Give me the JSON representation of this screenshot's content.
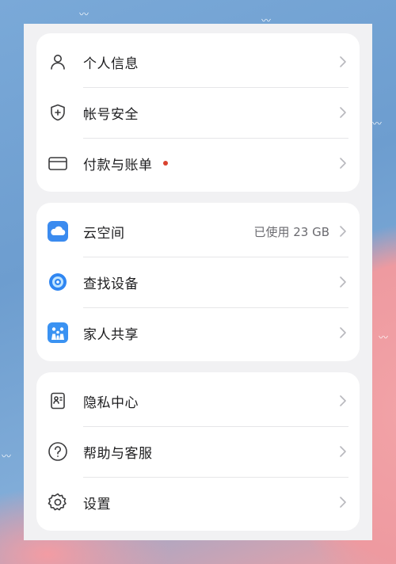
{
  "theme": {
    "accent_dot": "#d9432f",
    "cloud_blue": "#3b8bef",
    "find_blue": "#2f86f2",
    "family_blue": "#3a92f2"
  },
  "groups": [
    {
      "items": [
        {
          "label": "个人信息",
          "icon": "person-icon"
        },
        {
          "label": "帐号安全",
          "icon": "shield-icon"
        },
        {
          "label": "付款与账单",
          "icon": "card-icon",
          "badge": "red-dot"
        }
      ]
    },
    {
      "items": [
        {
          "label": "云空间",
          "icon": "cloud-icon",
          "value": "已使用 23 GB"
        },
        {
          "label": "查找设备",
          "icon": "find-device-icon"
        },
        {
          "label": "家人共享",
          "icon": "family-icon"
        }
      ]
    },
    {
      "items": [
        {
          "label": "隐私中心",
          "icon": "privacy-icon"
        },
        {
          "label": "帮助与客服",
          "icon": "help-icon"
        },
        {
          "label": "设置",
          "icon": "gear-icon"
        }
      ]
    }
  ]
}
